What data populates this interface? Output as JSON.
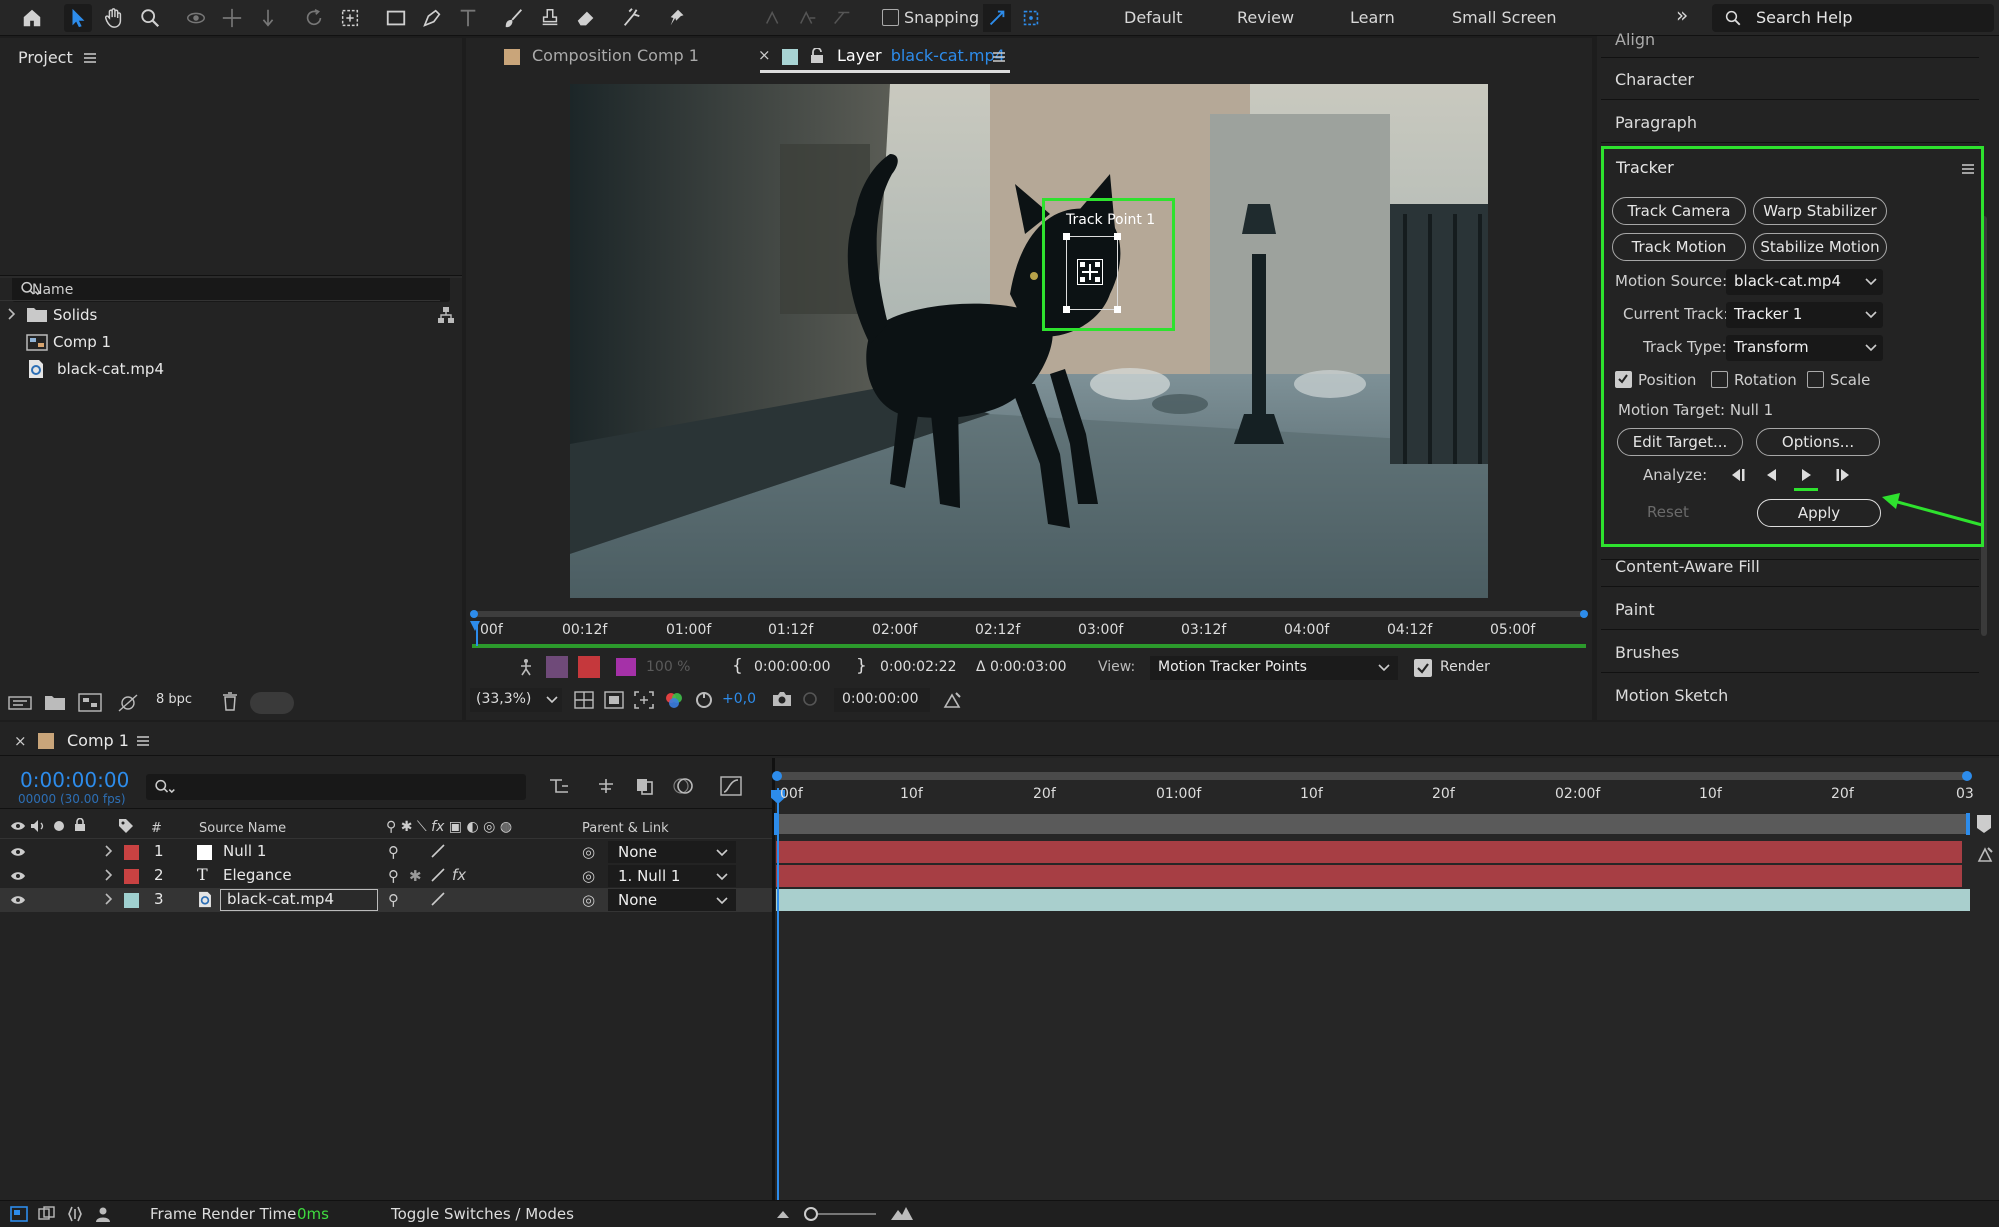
{
  "toolbar": {
    "snapping_label": "Snapping",
    "workspaces": [
      "Default",
      "Review",
      "Learn",
      "Small Screen"
    ],
    "overflow": "»",
    "search_placeholder": "Search Help",
    "icons": [
      "home-icon",
      "selection-arrow-icon",
      "hand-icon",
      "zoom-icon",
      "orbit-icon",
      "pan-icon",
      "dolly-icon",
      "rotate-icon",
      "pan-behind-icon",
      "rectangle-icon",
      "pen-icon",
      "type-icon",
      "brush-icon",
      "clone-stamp-icon",
      "eraser-icon",
      "roto-brush-icon",
      "puppet-pin-icon"
    ]
  },
  "project": {
    "title": "Project",
    "column_name": "Name",
    "items": [
      {
        "name": "Solids",
        "icon": "folder-icon"
      },
      {
        "name": "Comp 1",
        "icon": "composition-icon"
      },
      {
        "name": "black-cat.mp4",
        "icon": "footage-icon"
      }
    ],
    "bpc": "8 bpc"
  },
  "viewer": {
    "comp_tab_label": "Composition Comp 1",
    "layer_tab_prefix": "Layer",
    "layer_tab_name": "black-cat.mp4",
    "track_point_label": "Track Point 1",
    "ruler_ticks": [
      "00f",
      "00:12f",
      "01:00f",
      "01:12f",
      "02:00f",
      "02:12f",
      "03:00f",
      "03:12f",
      "04:00f",
      "04:12f",
      "05:00f"
    ],
    "opacity": "100 %",
    "in_time": "0:00:00:00",
    "out_time": "0:00:02:22",
    "duration": "Δ 0:00:03:00",
    "view_label": "View:",
    "view_value": "Motion Tracker Points",
    "render_label": "Render",
    "zoom": "(33,3%)",
    "exposure": "+0,0",
    "current_time": "0:00:00:00"
  },
  "right_panel": {
    "items_top": [
      "Align",
      "Character",
      "Paragraph"
    ],
    "items_bottom": [
      "Content-Aware Fill",
      "Paint",
      "Brushes",
      "Motion Sketch"
    ],
    "tracker": {
      "title": "Tracker",
      "track_camera": "Track Camera",
      "warp_stabilizer": "Warp Stabilizer",
      "track_motion": "Track Motion",
      "stabilize_motion": "Stabilize Motion",
      "motion_source_label": "Motion Source:",
      "motion_source_value": "black-cat.mp4",
      "current_track_label": "Current Track:",
      "current_track_value": "Tracker 1",
      "track_type_label": "Track Type:",
      "track_type_value": "Transform",
      "position_label": "Position",
      "position_checked": true,
      "rotation_label": "Rotation",
      "rotation_checked": false,
      "scale_label": "Scale",
      "scale_checked": false,
      "motion_target": "Motion Target: Null 1",
      "edit_target": "Edit Target...",
      "options": "Options...",
      "analyze_label": "Analyze:",
      "reset": "Reset",
      "apply": "Apply"
    }
  },
  "timeline": {
    "comp_tab": "Comp 1",
    "current_time": "0:00:00:00",
    "frame_info": "00000 (30.00 fps)",
    "col_hash": "#",
    "col_source": "Source Name",
    "col_parent": "Parent & Link",
    "ruler": [
      "00f",
      "10f",
      "20f",
      "01:00f",
      "10f",
      "20f",
      "02:00f",
      "10f",
      "20f",
      "03"
    ],
    "layers": [
      {
        "num": "1",
        "name": "Null 1",
        "label_color": "#c94242",
        "type_icon": "null-icon",
        "parent": "None"
      },
      {
        "num": "2",
        "name": "Elegance",
        "label_color": "#c94242",
        "type_icon": "text-layer-icon",
        "parent": "1. Null 1"
      },
      {
        "num": "3",
        "name": "black-cat.mp4",
        "label_color": "#9fd0cf",
        "type_icon": "footage-icon",
        "parent": "None"
      }
    ],
    "colors": {
      "bar_red": "#a73e44",
      "bar_teal": "#a9cfcd",
      "accent_blue": "#2d8ceb",
      "tracker_green": "#2ee22e"
    }
  },
  "status": {
    "frame_render_label": "Frame Render Time",
    "frame_render_value": "0ms",
    "toggle_label": "Toggle Switches / Modes"
  }
}
